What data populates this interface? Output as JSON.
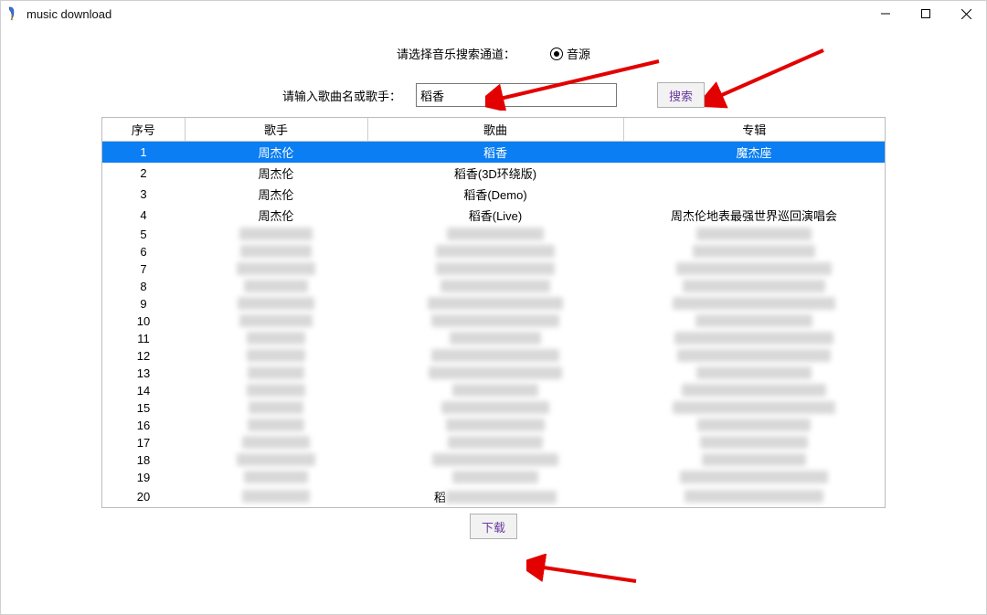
{
  "window": {
    "title": "music download"
  },
  "channel": {
    "label": "请选择音乐搜索通道：",
    "option": "音源"
  },
  "search": {
    "label": "请输入歌曲名或歌手：",
    "value": "稻香",
    "button": "搜索"
  },
  "table": {
    "headers": {
      "idx": "序号",
      "artist": "歌手",
      "song": "歌曲",
      "album": "专辑"
    },
    "rows": [
      {
        "idx": "1",
        "artist": "周杰伦",
        "song": "稻香",
        "album": "魔杰座",
        "selected": true
      },
      {
        "idx": "2",
        "artist": "周杰伦",
        "song": "稻香(3D环绕版)",
        "album": ""
      },
      {
        "idx": "3",
        "artist": "周杰伦",
        "song": "稻香(Demo)",
        "album": ""
      },
      {
        "idx": "4",
        "artist": "周杰伦",
        "song": "稻香(Live)",
        "album": "周杰伦地表最强世界巡回演唱会"
      },
      {
        "idx": "5",
        "blur": true
      },
      {
        "idx": "6",
        "blur": true
      },
      {
        "idx": "7",
        "blur": true
      },
      {
        "idx": "8",
        "blur": true
      },
      {
        "idx": "9",
        "blur": true
      },
      {
        "idx": "10",
        "blur": true
      },
      {
        "idx": "11",
        "blur": true
      },
      {
        "idx": "12",
        "blur": true
      },
      {
        "idx": "13",
        "blur": true
      },
      {
        "idx": "14",
        "blur": true
      },
      {
        "idx": "15",
        "blur": true
      },
      {
        "idx": "16",
        "blur": true
      },
      {
        "idx": "17",
        "blur": true
      },
      {
        "idx": "18",
        "blur": true
      },
      {
        "idx": "19",
        "blur": true
      },
      {
        "idx": "20",
        "blur": true,
        "song_prefix": "稻"
      }
    ]
  },
  "download": {
    "button": "下载"
  }
}
